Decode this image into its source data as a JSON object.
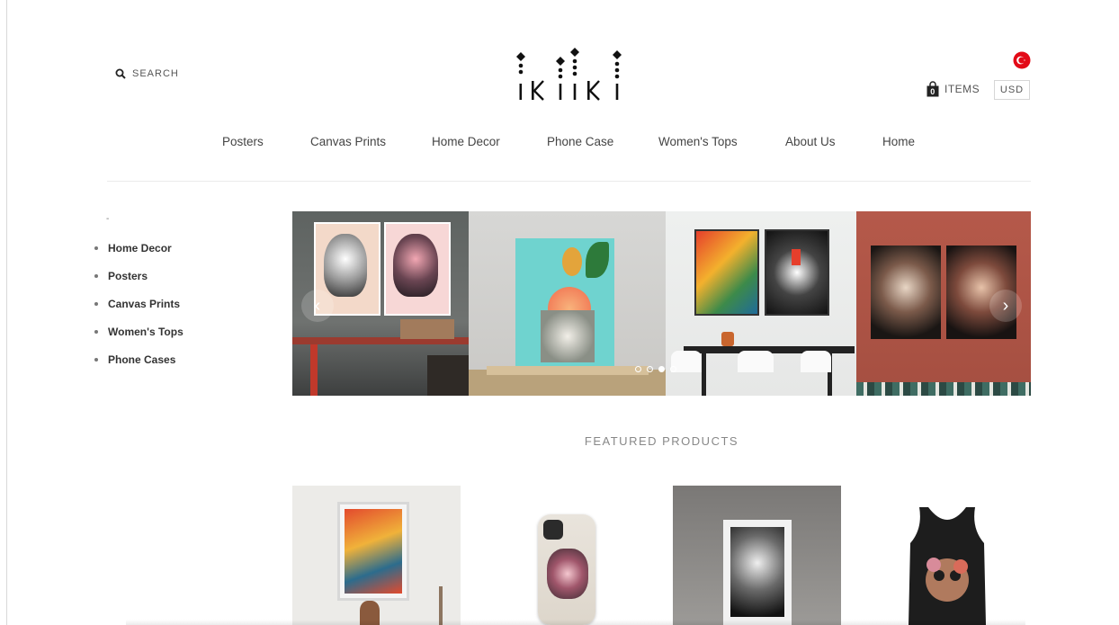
{
  "header": {
    "search_label": "SEARCH",
    "cart_count": "0",
    "cart_label": "ITEMS",
    "currency": "USD"
  },
  "nav": {
    "items": [
      "Posters",
      "Canvas Prints",
      "Home Decor",
      "Phone Case",
      "Women's Tops",
      "About Us",
      "Home"
    ]
  },
  "sidebar": {
    "dash": "-",
    "items": [
      "Home Decor",
      "Posters",
      "Canvas Prints",
      "Women's Tops",
      "Phone Cases"
    ]
  },
  "slider": {
    "prev_glyph": "‹",
    "next_glyph": "›",
    "slide_count": 4,
    "active_slide": 3
  },
  "featured": {
    "title": "FEATURED PRODUCTS"
  },
  "colors": {
    "flag_red": "#e30a17",
    "text_dark": "#333333"
  }
}
